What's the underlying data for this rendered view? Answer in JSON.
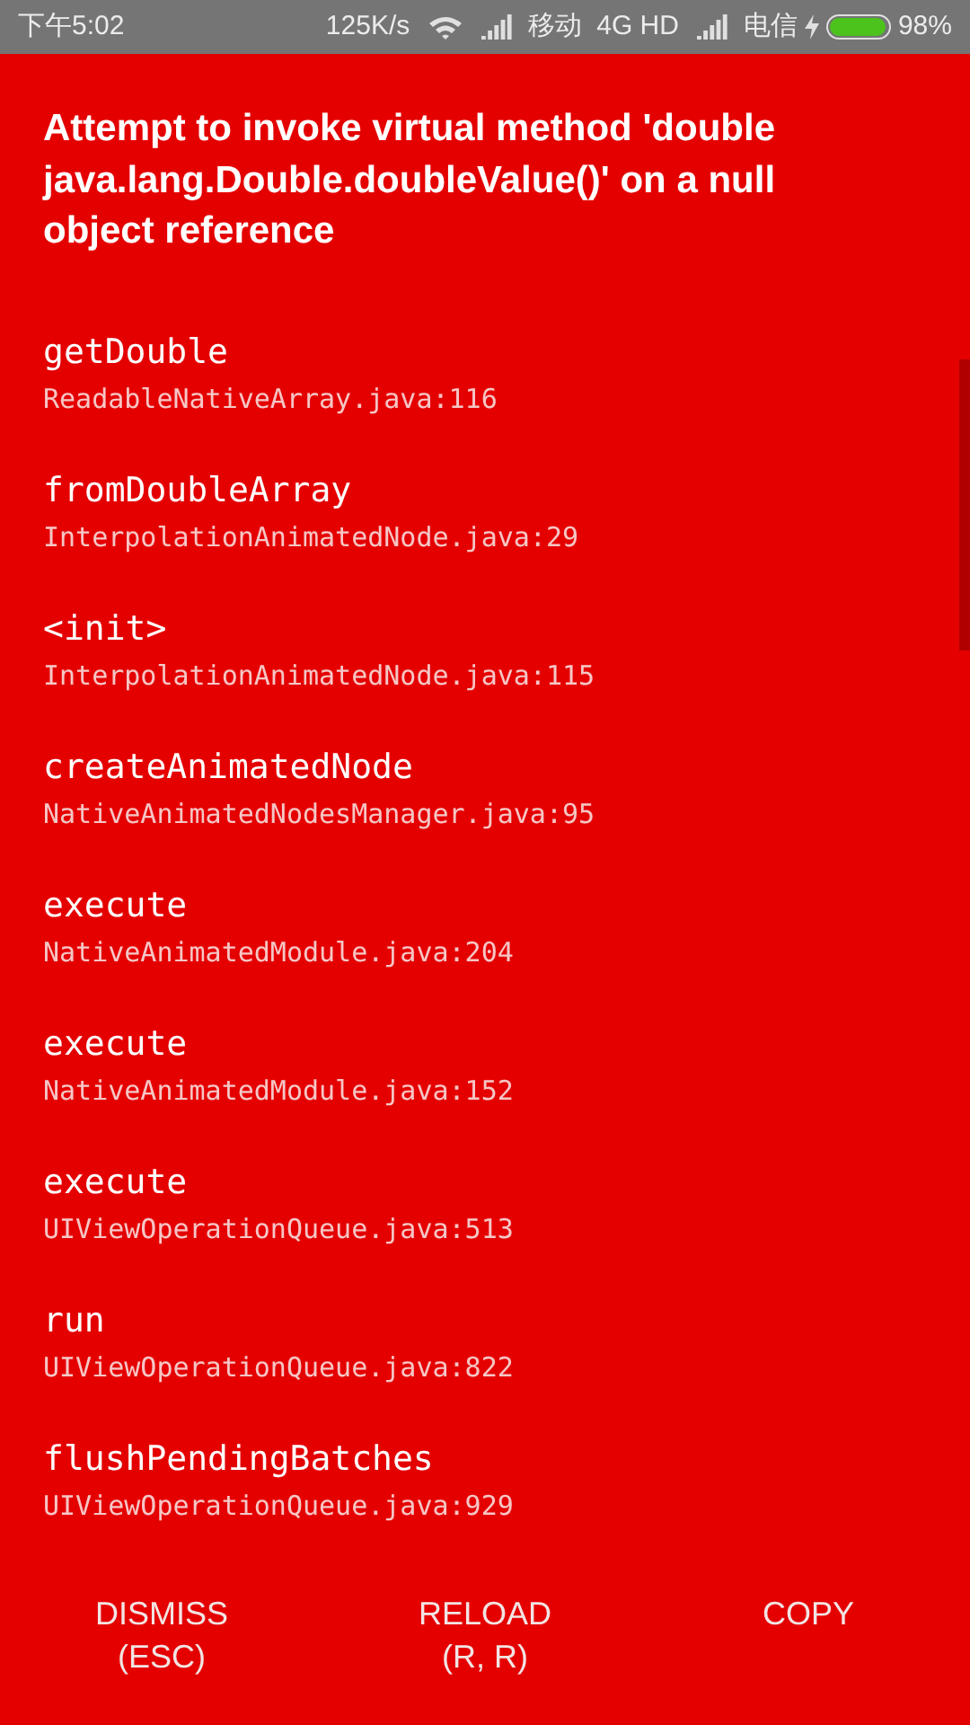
{
  "status_bar": {
    "time": "下午5:02",
    "speed": "125K/s",
    "carrier_1": "移动",
    "network": "4G HD",
    "carrier_2": "电信",
    "battery": {
      "level": 0.98,
      "percent": "98%"
    }
  },
  "error": {
    "message": "Attempt to invoke virtual method 'double java.lang.Double.doubleValue()' on a null object reference"
  },
  "stack": [
    {
      "method": "getDouble",
      "location": "ReadableNativeArray.java:116"
    },
    {
      "method": "fromDoubleArray",
      "location": "InterpolationAnimatedNode.java:29"
    },
    {
      "method": "<init>",
      "location": "InterpolationAnimatedNode.java:115"
    },
    {
      "method": "createAnimatedNode",
      "location": "NativeAnimatedNodesManager.java:95"
    },
    {
      "method": "execute",
      "location": "NativeAnimatedModule.java:204"
    },
    {
      "method": "execute",
      "location": "NativeAnimatedModule.java:152"
    },
    {
      "method": "execute",
      "location": "UIViewOperationQueue.java:513"
    },
    {
      "method": "run",
      "location": "UIViewOperationQueue.java:822"
    },
    {
      "method": "flushPendingBatches",
      "location": "UIViewOperationQueue.java:929"
    }
  ],
  "buttons": [
    {
      "label": "DISMISS",
      "hint": "(ESC)"
    },
    {
      "label": "RELOAD",
      "hint": "(R, R)"
    },
    {
      "label": "COPY"
    }
  ]
}
